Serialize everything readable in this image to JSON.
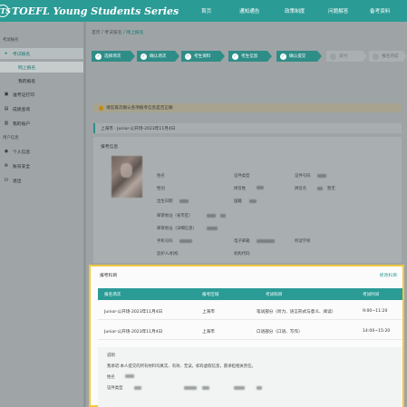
{
  "header": {
    "logo_mark": "ETS",
    "logo_text": "TOEFL Young Students Series",
    "nav": [
      "首页",
      "通知通告",
      "政策制度",
      "问题解答",
      "备考资料"
    ]
  },
  "sidebar": {
    "group1": "考试报名",
    "items": [
      {
        "icon": "▸",
        "label": "考试报名"
      },
      {
        "icon": "",
        "label": "网上报名"
      },
      {
        "icon": "",
        "label": "我的报名"
      },
      {
        "icon": "▣",
        "label": "准考证打印"
      },
      {
        "icon": "▤",
        "label": "成绩查询"
      },
      {
        "icon": "▥",
        "label": "我的账户"
      }
    ],
    "group2": "用户信息",
    "items2": [
      {
        "icon": "◉",
        "label": "个人信息"
      },
      {
        "icon": "⚙",
        "label": "账号安全"
      },
      {
        "icon": "⏻",
        "label": "退出"
      }
    ]
  },
  "breadcrumb": {
    "home": "首页",
    "sep": "/",
    "mid": "考试报名",
    "current": "网上报名"
  },
  "steps": [
    {
      "label": "选择场次",
      "done": true
    },
    {
      "label": "确认场次",
      "done": true
    },
    {
      "label": "考生资料",
      "done": true
    },
    {
      "label": "考生信息",
      "done": true
    },
    {
      "label": "确认提交",
      "done": true
    },
    {
      "label": "支付",
      "done": false
    },
    {
      "label": "报名完成",
      "done": false
    }
  ],
  "notice": "请您再次确认各项报考信息是否正确",
  "venue": "上海市 · Junior-公开场-2023年11月4日",
  "info_card": {
    "title": "报考信息",
    "fields": {
      "name": "姓名",
      "gender": "性别",
      "birth": "出生日期",
      "id_type": "证件类型",
      "pinyin": "拼音姓",
      "nation": "国籍",
      "id_no": "证件号码",
      "pinyin_name": "拼音名",
      "address": "邮寄地址（省市区）",
      "address_detail": "邮寄地址（详细信息）",
      "phone": "手机号码",
      "email": "电子邮箱",
      "school": "所读学校",
      "guardian": "监护人/机构",
      "org_code": "机构代码"
    },
    "options": {
      "pinyin_none_label": "暂无"
    }
  },
  "exam_card": {
    "title": "报考科目",
    "edit": "修改科目",
    "columns": [
      "报名场次",
      "报考区域",
      "考试科目",
      "考试时间"
    ],
    "rows": [
      [
        "Junior-公开场-2023年11月4日",
        "上海市",
        "笔试部分（听力、语言形式与意义、阅读）",
        "9:00~11:20"
      ],
      [
        "Junior-公开场-2023年11月4日",
        "上海市",
        "口语部分（口语、写作）",
        "14:00~15:20"
      ]
    ],
    "notes_title": "说明",
    "notes_line1": "我承诺:本人提交的所有材料均真实、有效、无误，如有虚假信息，愿承担相关责任。",
    "notes_sign": "姓名",
    "notes_id": "证件类型"
  },
  "colors": {
    "brand": "#2b9b96",
    "highlight": "#f3c73e",
    "warning": "#c08a12"
  }
}
